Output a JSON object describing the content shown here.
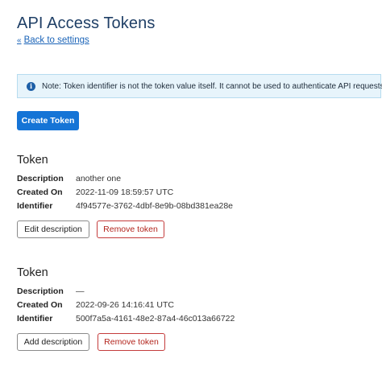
{
  "page": {
    "title": "API Access Tokens",
    "back_link": {
      "icon": "double-chevron-left-icon",
      "glyph": "«",
      "label": "Back to settings"
    }
  },
  "notice": {
    "icon": "info-icon",
    "icon_glyph": "i",
    "text": "Note: Token identifier is not the token value itself. It cannot be used to authenticate API requests.",
    "background": "#e7f4fb",
    "border": "#b6dcef"
  },
  "create_button": {
    "label": "Create Token",
    "color": "#1574d6"
  },
  "field_labels": {
    "description": "Description",
    "created_on": "Created On",
    "identifier": "Identifier"
  },
  "tokens": [
    {
      "heading": "Token",
      "description": "another one",
      "created_on": "2022-11-09 18:59:57 UTC",
      "identifier": "4f94577e-3762-4dbf-8e9b-08bd381ea28e",
      "primary_action": "Edit description",
      "remove_action": "Remove token"
    },
    {
      "heading": "Token",
      "description": "—",
      "created_on": "2022-09-26 14:16:41 UTC",
      "identifier": "500f7a5a-4161-48e2-87a4-46c013a66722",
      "primary_action": "Add description",
      "remove_action": "Remove token"
    }
  ]
}
